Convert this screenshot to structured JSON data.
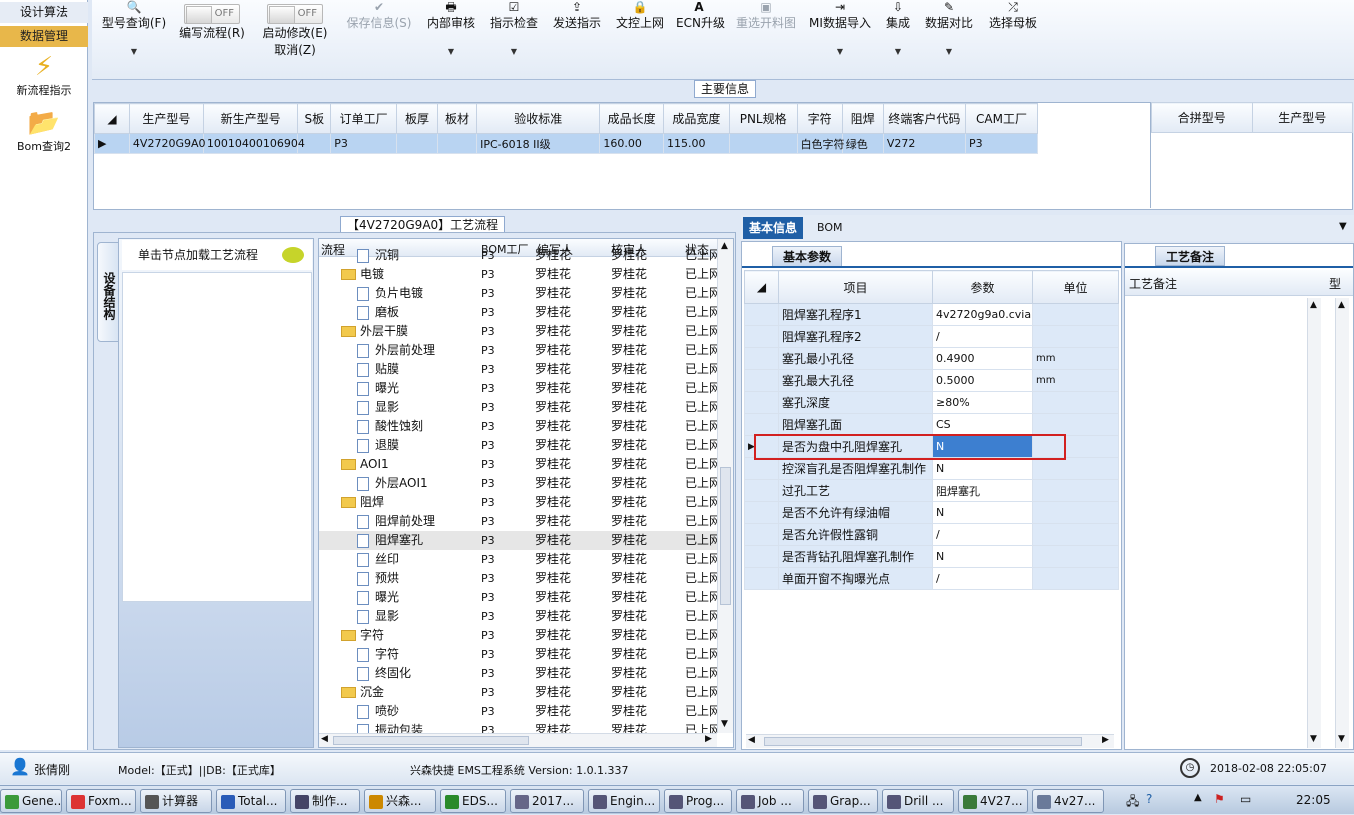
{
  "leftnav": {
    "algo": "设计算法",
    "data": "数据管理",
    "flow": "新流程指示",
    "bom": "Bom查询2"
  },
  "toolbar": {
    "model_query": "型号查询(F)",
    "edit_flow": "编写流程(R)",
    "edit_toggle": "OFF",
    "start_modify": "启动修改(E)",
    "cancel": "取消(Z)",
    "modify_toggle": "OFF",
    "save": "保存信息(S)",
    "internal_review": "内部审核",
    "indicator_check": "指示检查",
    "send": "发送指示",
    "doc_upload": "文控上网",
    "ecn": "ECN升级",
    "reselect": "重选开料图",
    "mi_import": "MI数据导入",
    "integrate": "集成",
    "compare": "数据对比",
    "select_master": "选择母板"
  },
  "main_info": {
    "caption": "主要信息",
    "columns": [
      "生产型号",
      "新生产型号",
      "S板",
      "订单工厂",
      "板厚",
      "板材",
      "验收标准",
      "成品长度",
      "成品宽度",
      "PNL规格",
      "字符",
      "阻焊",
      "终端客户代码",
      "CAM工厂"
    ],
    "row": [
      "4V2720G9A0",
      "10010400106904",
      "",
      "P3",
      "",
      "",
      "IPC-6018 II级",
      "160.00",
      "115.00",
      "",
      "白色字符",
      "绿色",
      "V272",
      "P3"
    ],
    "side_columns": [
      "合拼型号",
      "生产型号"
    ]
  },
  "process": {
    "caption": "【4V2720G9A0】工艺流程",
    "vtab": "设备结构",
    "node_hint": "单击节点加载工艺流程",
    "columns": [
      "流程",
      "BOM工厂",
      "编写人",
      "核审人",
      "状态"
    ],
    "rows": [
      {
        "name": "沉铜",
        "lvl": 1,
        "folder": false,
        "f": "P3",
        "w": "罗桂花",
        "r": "罗桂花",
        "s": "已上网"
      },
      {
        "name": "电镀",
        "lvl": 0,
        "folder": true,
        "f": "P3",
        "w": "罗桂花",
        "r": "罗桂花",
        "s": "已上网"
      },
      {
        "name": "负片电镀",
        "lvl": 1,
        "folder": false,
        "f": "P3",
        "w": "罗桂花",
        "r": "罗桂花",
        "s": "已上网"
      },
      {
        "name": "磨板",
        "lvl": 1,
        "folder": false,
        "f": "P3",
        "w": "罗桂花",
        "r": "罗桂花",
        "s": "已上网"
      },
      {
        "name": "外层干膜",
        "lvl": 0,
        "folder": true,
        "f": "P3",
        "w": "罗桂花",
        "r": "罗桂花",
        "s": "已上网"
      },
      {
        "name": "外层前处理",
        "lvl": 1,
        "folder": false,
        "f": "P3",
        "w": "罗桂花",
        "r": "罗桂花",
        "s": "已上网"
      },
      {
        "name": "贴膜",
        "lvl": 1,
        "folder": false,
        "f": "P3",
        "w": "罗桂花",
        "r": "罗桂花",
        "s": "已上网"
      },
      {
        "name": "曝光",
        "lvl": 1,
        "folder": false,
        "f": "P3",
        "w": "罗桂花",
        "r": "罗桂花",
        "s": "已上网"
      },
      {
        "name": "显影",
        "lvl": 1,
        "folder": false,
        "f": "P3",
        "w": "罗桂花",
        "r": "罗桂花",
        "s": "已上网"
      },
      {
        "name": "酸性蚀刻",
        "lvl": 1,
        "folder": false,
        "f": "P3",
        "w": "罗桂花",
        "r": "罗桂花",
        "s": "已上网"
      },
      {
        "name": "退膜",
        "lvl": 1,
        "folder": false,
        "f": "P3",
        "w": "罗桂花",
        "r": "罗桂花",
        "s": "已上网"
      },
      {
        "name": "AOI1",
        "lvl": 0,
        "folder": true,
        "f": "P3",
        "w": "罗桂花",
        "r": "罗桂花",
        "s": "已上网"
      },
      {
        "name": "外层AOI1",
        "lvl": 1,
        "folder": false,
        "f": "P3",
        "w": "罗桂花",
        "r": "罗桂花",
        "s": "已上网"
      },
      {
        "name": "阻焊",
        "lvl": 0,
        "folder": true,
        "f": "P3",
        "w": "罗桂花",
        "r": "罗桂花",
        "s": "已上网"
      },
      {
        "name": "阻焊前处理",
        "lvl": 1,
        "folder": false,
        "f": "P3",
        "w": "罗桂花",
        "r": "罗桂花",
        "s": "已上网"
      },
      {
        "name": "阻焊塞孔",
        "lvl": 1,
        "folder": false,
        "f": "P3",
        "w": "罗桂花",
        "r": "罗桂花",
        "s": "已上网",
        "sel": true
      },
      {
        "name": "丝印",
        "lvl": 1,
        "folder": false,
        "f": "P3",
        "w": "罗桂花",
        "r": "罗桂花",
        "s": "已上网"
      },
      {
        "name": "预烘",
        "lvl": 1,
        "folder": false,
        "f": "P3",
        "w": "罗桂花",
        "r": "罗桂花",
        "s": "已上网"
      },
      {
        "name": "曝光",
        "lvl": 1,
        "folder": false,
        "f": "P3",
        "w": "罗桂花",
        "r": "罗桂花",
        "s": "已上网"
      },
      {
        "name": "显影",
        "lvl": 1,
        "folder": false,
        "f": "P3",
        "w": "罗桂花",
        "r": "罗桂花",
        "s": "已上网"
      },
      {
        "name": "字符",
        "lvl": 0,
        "folder": true,
        "f": "P3",
        "w": "罗桂花",
        "r": "罗桂花",
        "s": "已上网"
      },
      {
        "name": "字符",
        "lvl": 1,
        "folder": false,
        "f": "P3",
        "w": "罗桂花",
        "r": "罗桂花",
        "s": "已上网"
      },
      {
        "name": "终固化",
        "lvl": 1,
        "folder": false,
        "f": "P3",
        "w": "罗桂花",
        "r": "罗桂花",
        "s": "已上网"
      },
      {
        "name": "沉金",
        "lvl": 0,
        "folder": true,
        "f": "P3",
        "w": "罗桂花",
        "r": "罗桂花",
        "s": "已上网"
      },
      {
        "name": "喷砂",
        "lvl": 1,
        "folder": false,
        "f": "P3",
        "w": "罗桂花",
        "r": "罗桂花",
        "s": "已上网"
      },
      {
        "name": "振动包装",
        "lvl": 1,
        "folder": false,
        "f": "P3",
        "w": "罗桂花",
        "r": "罗桂花",
        "s": "已上网"
      }
    ]
  },
  "basic": {
    "tab_basic": "基本信息",
    "tab_bom": "BOM",
    "subtab": "基本参数",
    "columns": [
      "项目",
      "参数",
      "单位"
    ],
    "rows": [
      {
        "item": "阻焊塞孔程序1",
        "value": "4v2720g9a0.cvia",
        "unit": ""
      },
      {
        "item": "阻焊塞孔程序2",
        "value": "/",
        "unit": ""
      },
      {
        "item": "塞孔最小孔径",
        "value": "0.4900",
        "unit": "mm"
      },
      {
        "item": "塞孔最大孔径",
        "value": "0.5000",
        "unit": "mm"
      },
      {
        "item": "塞孔深度",
        "value": "≥80%",
        "unit": ""
      },
      {
        "item": "阻焊塞孔面",
        "value": "CS",
        "unit": ""
      },
      {
        "item": "是否为盘中孔阻焊塞孔",
        "value": "N",
        "unit": "",
        "current": true
      },
      {
        "item": "控深盲孔是否阻焊塞孔制作",
        "value": "N",
        "unit": ""
      },
      {
        "item": "过孔工艺",
        "value": "阻焊塞孔",
        "unit": ""
      },
      {
        "item": "是否不允许有绿油帽",
        "value": "N",
        "unit": ""
      },
      {
        "item": "是否允许假性露铜",
        "value": "/",
        "unit": ""
      },
      {
        "item": "是否背钻孔阻焊塞孔制作",
        "value": "N",
        "unit": ""
      },
      {
        "item": "单面开窗不掏曝光点",
        "value": "/",
        "unit": ""
      }
    ]
  },
  "notes": {
    "tab": "工艺备注",
    "col1": "工艺备注",
    "col2": "型"
  },
  "status": {
    "user": "张倩刚",
    "model_db": "Model:【正式】||DB:【正式库】",
    "system": "兴森快捷 EMS工程系统 Version: 1.0.1.337",
    "datetime": "2018-02-08 22:05:07"
  },
  "taskbar": {
    "items": [
      "Gene...",
      "Foxm...",
      "计算器",
      "Total...",
      "制作...",
      "兴森...",
      "EDS...",
      "2017...",
      "Engin...",
      "Prog...",
      "Job ...",
      "Grap...",
      "Drill ...",
      "4V27...",
      "4v27..."
    ],
    "clock": "22:05"
  },
  "colors": {
    "highlight_box": "#d22020",
    "selected_row": "#b9d4f2",
    "nav_active": "#e8b74a",
    "tab_active": "#1f5fa6"
  }
}
